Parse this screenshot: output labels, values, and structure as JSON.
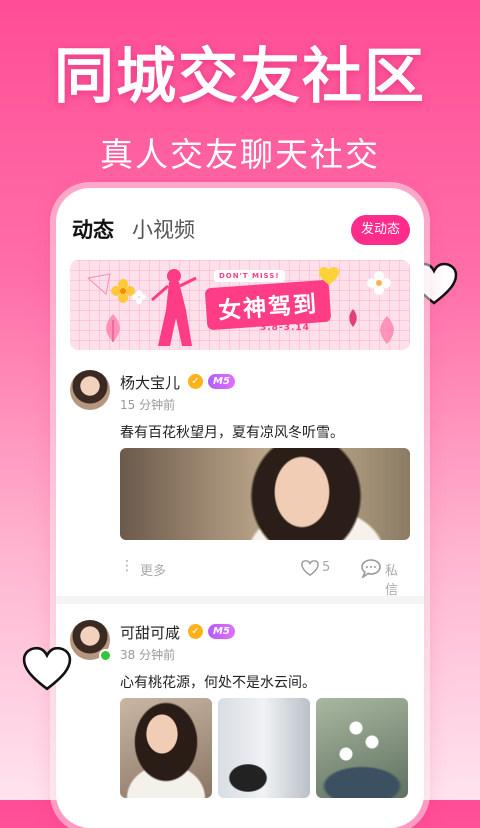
{
  "hero": {
    "title": "同城交友社区",
    "subtitle": "真人交友聊天社交"
  },
  "tabs": [
    {
      "label": "动态",
      "active": true
    },
    {
      "label": "小视频",
      "active": false
    }
  ],
  "post_button": {
    "label": "发动态"
  },
  "banner": {
    "tag": "DON'T MISS!",
    "title": "女神驾到",
    "date": "3.8-3.14"
  },
  "posts": [
    {
      "name": "杨大宝儿",
      "level": "M5",
      "time": "15 分钟前",
      "text": "春有百花秋望月，夏有凉风冬听雪。",
      "more_label": "更多",
      "likes": "5",
      "message_label": "私信"
    },
    {
      "name": "可甜可咸",
      "level": "M5",
      "time": "38 分钟前",
      "text": "心有桃花源，何处不是水云间。",
      "online": true
    }
  ],
  "colors": {
    "accent": "#ff2c8c",
    "verified": "#ffb31a",
    "level_badge": "#b45cff",
    "online": "#35c43c"
  },
  "icons": [
    "heart-outline-icon",
    "verified-check-icon",
    "more-dots-icon",
    "like-heart-icon",
    "chat-bubble-icon"
  ]
}
